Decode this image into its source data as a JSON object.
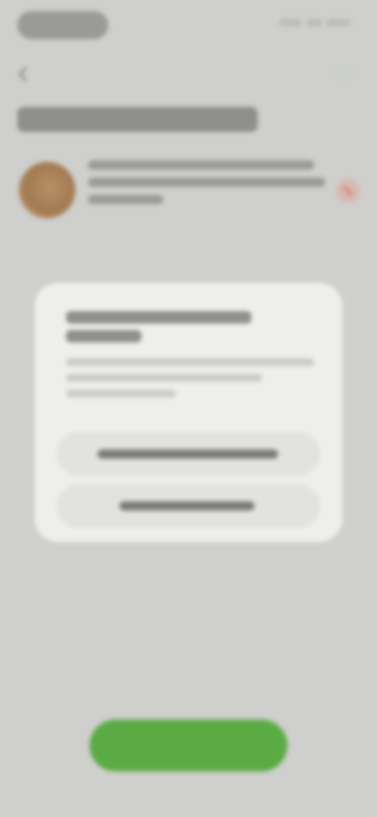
{
  "screen": {
    "background": "#cfcfcd",
    "dialog_background": "#eeeeec",
    "primary_button_color": "#5aab44",
    "remove_accent_color": "#d28776"
  },
  "status_bar": {
    "time_icon": "status-time-pill",
    "indicators": [
      "signal-icon",
      "wifi-icon",
      "battery-icon"
    ]
  },
  "header": {
    "back_icon": "chevron-left-icon"
  },
  "product": {
    "remove_icon": "remove-icon"
  },
  "dialog": {
    "buttons": [
      {
        "name": "dialog-primary-button"
      },
      {
        "name": "dialog-secondary-button"
      }
    ]
  },
  "footer": {
    "cta_name": "primary-action-button"
  }
}
